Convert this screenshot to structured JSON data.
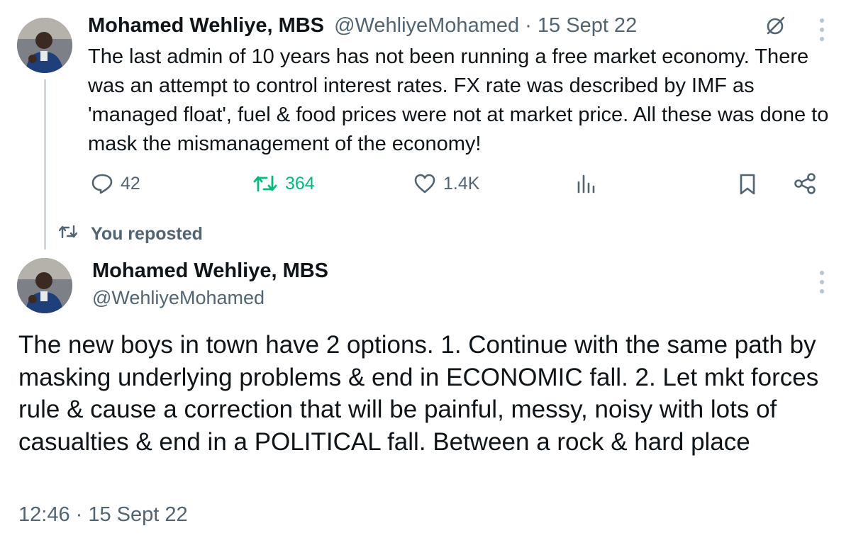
{
  "tweet1": {
    "author_name": "Mohamed Wehliye, MBS",
    "handle": "@WehliyeMohamed",
    "separator": "·",
    "date": "15 Sept 22",
    "text": "The last admin of 10 years has not been running a free market economy. There was an attempt to control interest rates. FX rate was described by IMF as 'managed float', fuel & food prices were not at market price. All these was done to mask the mismanagement of the economy!",
    "actions": {
      "replies": "42",
      "reposts": "364",
      "likes": "1.4K"
    },
    "icons": [
      "grok-icon",
      "more-icon",
      "reply-icon",
      "repost-icon",
      "like-icon",
      "views-icon",
      "bookmark-icon",
      "share-icon"
    ]
  },
  "repost_context": {
    "label": "You reposted"
  },
  "tweet2": {
    "author_name": "Mohamed Wehliye, MBS",
    "handle": "@WehliyeMohamed",
    "text": "The new boys in town have 2 options. 1. Continue with the same path by masking underlying problems & end in ECONOMIC fall. 2. Let mkt forces rule & cause a correction that will be painful, messy, noisy with lots of casualties & end in a POLITICAL fall. Between a rock & hard place",
    "timestamp": "12:46 · 15 Sept 22"
  },
  "colors": {
    "text": "#0f1419",
    "muted": "#536471",
    "repost_active": "#00ba7c",
    "thread_line": "#cfd9de"
  }
}
